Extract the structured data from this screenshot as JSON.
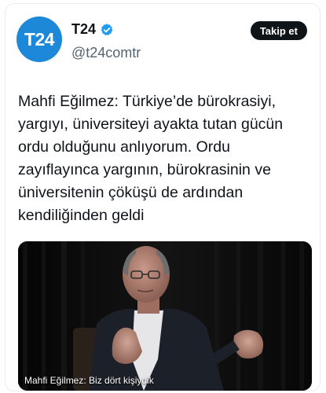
{
  "account": {
    "avatar_text": "T24",
    "display_name": "T24",
    "handle": "@t24comtr",
    "verified_icon": "verified-badge-icon",
    "brand_color": "#1e88d8"
  },
  "actions": {
    "follow_label": "Takip et"
  },
  "tweet": {
    "text": "Mahfi Eğilmez: Türkiye’de bürokrasiyi, yargıyı, üniversiteyi ayakta tutan gücün ordu olduğunu anlıyorum. Ordu zayıflayınca yargının, bürokrasinin ve üniversitenin çöküşü de ardından kendiliğinden geldi"
  },
  "media": {
    "caption": "Mahfi Eğilmez: Biz dört kişiydik"
  }
}
